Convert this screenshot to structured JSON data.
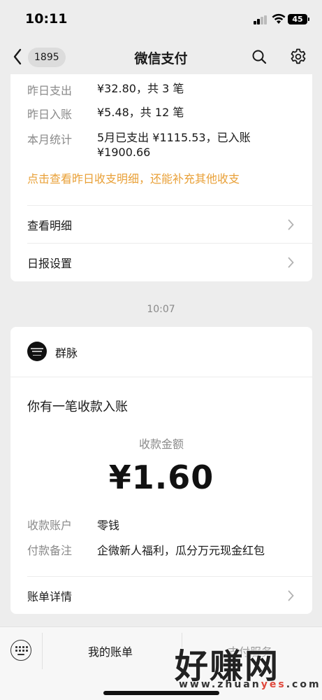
{
  "status_bar": {
    "time": "10:11",
    "battery": "45"
  },
  "nav": {
    "unread_count": "1895",
    "title": "微信支付"
  },
  "daily_report": {
    "rows": [
      {
        "label": "昨日支出",
        "value": "¥32.80，共 3 笔"
      },
      {
        "label": "昨日入账",
        "value": "¥5.48，共 12 笔"
      },
      {
        "label": "本月统计",
        "value_line1": "5月已支出 ¥1115.53，已入账",
        "value_line2": "¥1900.66"
      }
    ],
    "link_text": "点击查看昨日收支明细，还能补充其他收支",
    "menu": [
      {
        "label": "查看明细"
      },
      {
        "label": "日报设置"
      }
    ]
  },
  "timestamp": "10:07",
  "payment_notice": {
    "merchant_name": "群脉",
    "title": "你有一笔收款入账",
    "amount_label": "收款金额",
    "amount": "¥1.60",
    "details": [
      {
        "label": "收款账户",
        "value": "零钱"
      },
      {
        "label": "付款备注",
        "value": "企微新人福利，瓜分万元现金红包"
      }
    ],
    "bill_detail_label": "账单详情"
  },
  "bottom_bar": {
    "tabs": [
      {
        "label": "我的账单"
      },
      {
        "label": "支付服务"
      }
    ]
  },
  "watermark": {
    "main": "好赚网",
    "sub_a": "www.zhuan",
    "sub_b": "yes",
    "sub_c": ".com"
  },
  "colors": {
    "accent_orange": "#e9a037",
    "page_bg": "#ededed"
  }
}
